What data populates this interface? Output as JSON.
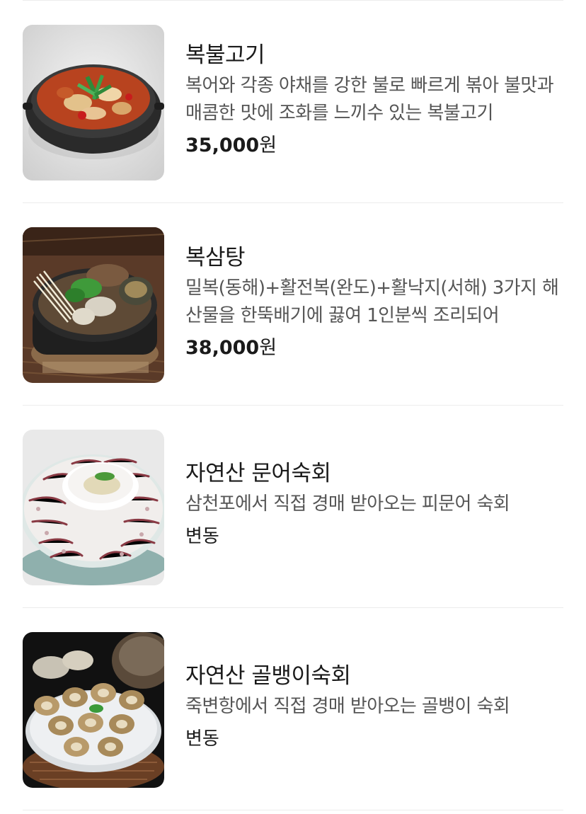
{
  "menu": {
    "items": [
      {
        "name": "복불고기",
        "description": "복어와 각종 야채를 강한 불로 빠르게 볶아 불맛과 매콤한 맛에 조화를 느끼수 있는 복불고기",
        "price_amount": "35,000",
        "price_unit": "원",
        "image": "spicy-stir-fried-pufferfish-dish-image"
      },
      {
        "name": "복삼탕",
        "description": "밀복(동해)+활전복(완도)+활낙지(서해) 3가지 해산물을 한뚝배기에 끓여 1인분씩 조리되어",
        "price_amount": "38,000",
        "price_unit": "원",
        "image": "seafood-hot-pot-dish-image"
      },
      {
        "name": "자연산 문어숙회",
        "description": "삼천포에서 직접 경매 받아오는 피문어 숙회",
        "price_text": "변동",
        "image": "boiled-octopus-platter-image"
      },
      {
        "name": "자연산 골뱅이숙회",
        "description": "죽변항에서 직접 경매 받아오는 골뱅이 숙회",
        "price_text": "변동",
        "image": "boiled-whelk-platter-image"
      }
    ]
  },
  "colors": {
    "divider": "#ececec",
    "title": "#1a1a1a",
    "description": "#555555",
    "background": "#ffffff"
  }
}
